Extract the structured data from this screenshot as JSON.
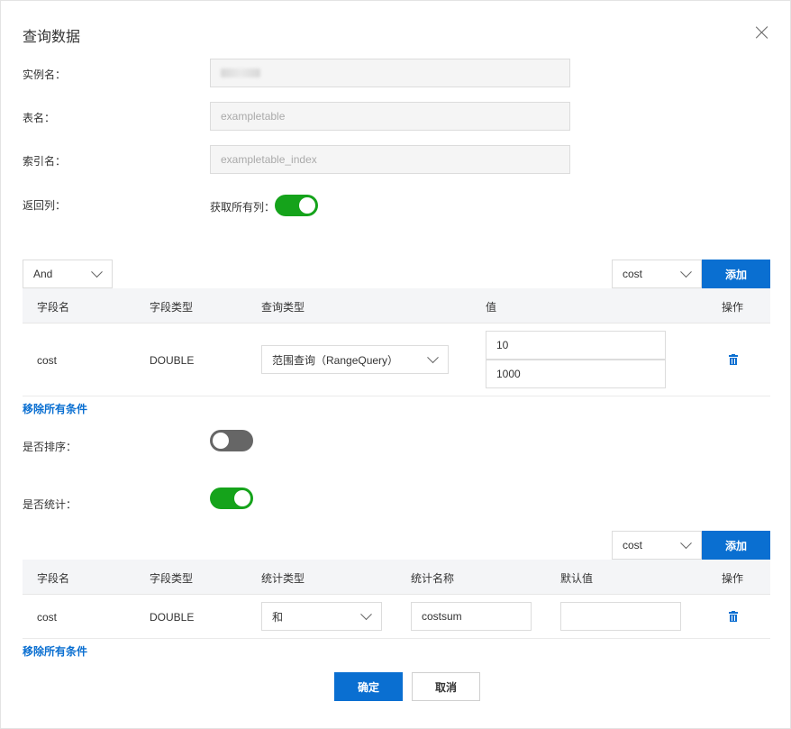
{
  "dialog": {
    "title": "查询数据"
  },
  "form": {
    "instance": {
      "label": "实例名：",
      "value": ""
    },
    "table": {
      "label": "表名：",
      "value": "exampletable"
    },
    "index": {
      "label": "索引名：",
      "value": "exampletable_index"
    },
    "columns": {
      "label": "返回列：",
      "get_all_label": "获取所有列：",
      "get_all_on": true
    }
  },
  "query": {
    "logic": "And",
    "field_select": "cost",
    "add_label": "添加",
    "headers": [
      "字段名",
      "字段类型",
      "查询类型",
      "值",
      "操作"
    ],
    "rows": [
      {
        "field": "cost",
        "type": "DOUBLE",
        "query_type": "范围查询（RangeQuery）",
        "value_from": "10",
        "value_to": "1000"
      }
    ],
    "remove_all": "移除所有条件"
  },
  "sort": {
    "label": "是否排序：",
    "on": false
  },
  "stats": {
    "label": "是否统计：",
    "on": true,
    "field_select": "cost",
    "add_label": "添加",
    "headers": [
      "字段名",
      "字段类型",
      "统计类型",
      "统计名称",
      "默认值",
      "操作"
    ],
    "rows": [
      {
        "field": "cost",
        "type": "DOUBLE",
        "stat_type": "和",
        "stat_name": "costsum",
        "default_value": ""
      }
    ],
    "remove_all": "移除所有条件"
  },
  "footer": {
    "confirm": "确定",
    "cancel": "取消"
  },
  "colors": {
    "primary": "#0a6fd1",
    "switch_on": "#15a31b",
    "switch_off": "#666666"
  }
}
